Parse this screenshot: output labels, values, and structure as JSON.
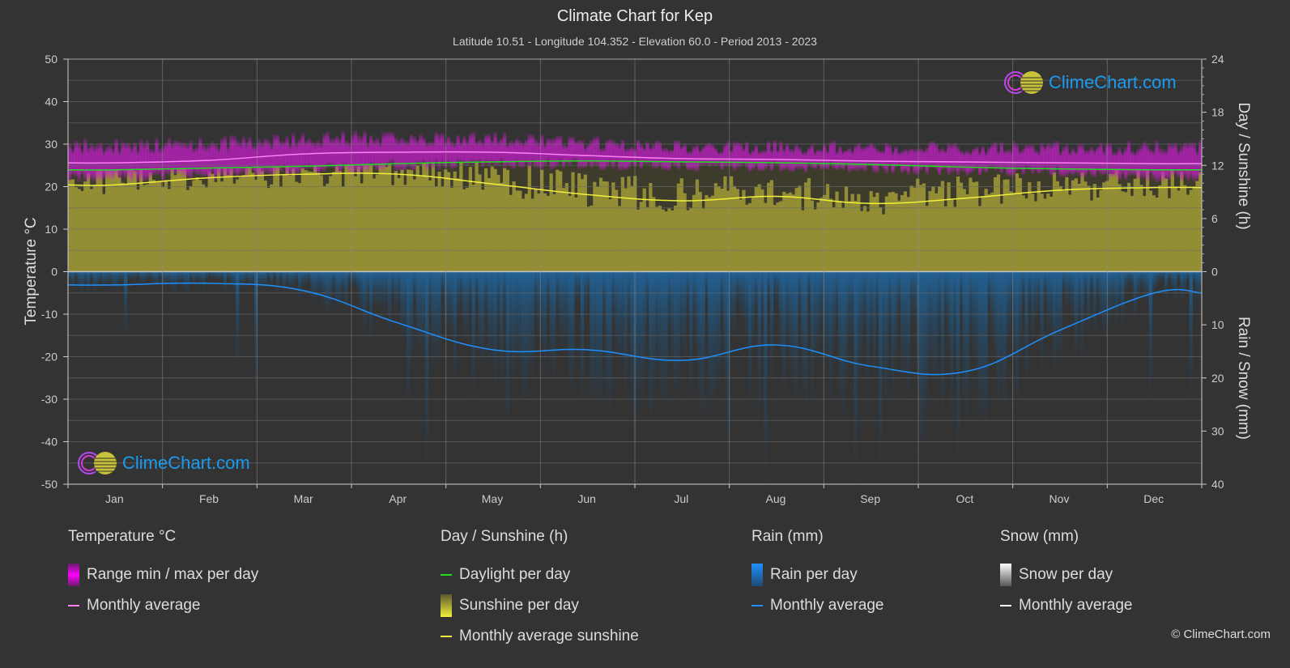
{
  "header": {
    "title": "Climate Chart for Kep",
    "subtitle": "Latitude 10.51 - Longitude 104.352 - Elevation 60.0 - Period 2013 - 2023"
  },
  "logo_text": "ClimeChart.com",
  "copyright": "© ClimeChart.com",
  "colors": {
    "background": "#333333",
    "temp_range": "#c81ecb",
    "temp_avg": "#ff7ff5",
    "daylight": "#22dd22",
    "sunshine_fill": "#9b9636",
    "sunshine_avg": "#f2f03a",
    "rain_fill": "#1e6aa8",
    "rain_avg": "#1e90ff",
    "snow_avg": "#ffffff",
    "grid": "#5c5c5c",
    "logo": "#1a9bf0"
  },
  "legend": {
    "temperature": {
      "title": "Temperature °C",
      "items": [
        "Range min / max per day",
        "Monthly average"
      ]
    },
    "sunshine": {
      "title": "Day / Sunshine (h)",
      "items": [
        "Daylight per day",
        "Sunshine per day",
        "Monthly average sunshine"
      ]
    },
    "rain": {
      "title": "Rain (mm)",
      "items": [
        "Rain per day",
        "Monthly average"
      ]
    },
    "snow": {
      "title": "Snow (mm)",
      "items": [
        "Snow per day",
        "Monthly average"
      ]
    }
  },
  "chart_data": {
    "type": "line",
    "title": "Climate Chart for Kep",
    "subtitle": "Latitude 10.51 - Longitude 104.352 - Elevation 60.0 - Period 2013 - 2023",
    "categories": [
      "Jan",
      "Feb",
      "Mar",
      "Apr",
      "May",
      "Jun",
      "Jul",
      "Aug",
      "Sep",
      "Oct",
      "Nov",
      "Dec"
    ],
    "axes": {
      "left": {
        "label": "Temperature °C",
        "range": [
          -50,
          50
        ],
        "ticks": [
          50,
          40,
          30,
          20,
          10,
          0,
          -10,
          -20,
          -30,
          -40,
          -50
        ]
      },
      "right_top": {
        "label": "Day / Sunshine (h)",
        "range": [
          0,
          24
        ],
        "ticks": [
          24,
          18,
          12,
          6,
          0
        ]
      },
      "right_bottom": {
        "label": "Rain / Snow (mm)",
        "range": [
          0,
          40
        ],
        "ticks": [
          0,
          10,
          20,
          30,
          40
        ]
      }
    },
    "grid": true,
    "legend_position": "bottom",
    "series": [
      {
        "name": "Temperature monthly average",
        "axis": "left",
        "unit": "°C",
        "values": [
          25.6,
          26.2,
          27.7,
          28.1,
          28.1,
          27.3,
          26.6,
          26.4,
          26.0,
          25.8,
          25.6,
          25.4
        ]
      },
      {
        "name": "Temperature daily max (approx band top)",
        "axis": "left",
        "unit": "°C",
        "values": [
          30.0,
          30.5,
          31.5,
          32.0,
          31.5,
          30.5,
          29.5,
          29.5,
          29.5,
          29.5,
          29.5,
          29.5
        ]
      },
      {
        "name": "Temperature daily min (approx band bottom)",
        "axis": "left",
        "unit": "°C",
        "values": [
          22.0,
          22.5,
          23.5,
          24.5,
          25.0,
          25.0,
          24.5,
          24.5,
          24.0,
          23.5,
          23.0,
          22.0
        ]
      },
      {
        "name": "Daylight per day",
        "axis": "right_top",
        "unit": "h",
        "values": [
          11.5,
          11.7,
          11.9,
          12.2,
          12.4,
          12.5,
          12.4,
          12.3,
          12.1,
          11.8,
          11.6,
          11.5
        ]
      },
      {
        "name": "Monthly average sunshine",
        "axis": "right_top",
        "unit": "h",
        "values": [
          9.8,
          10.6,
          11.0,
          11.0,
          9.9,
          8.7,
          8.0,
          8.5,
          7.7,
          8.3,
          9.2,
          9.5
        ]
      },
      {
        "name": "Rain monthly average",
        "axis": "right_bottom",
        "unit": "mm",
        "values": [
          2.5,
          2.2,
          3.6,
          9.7,
          14.7,
          14.7,
          16.7,
          13.8,
          17.8,
          18.8,
          11.0,
          4.0
        ]
      },
      {
        "name": "Snow monthly average",
        "axis": "right_bottom",
        "unit": "mm",
        "values": [
          0,
          0,
          0,
          0,
          0,
          0,
          0,
          0,
          0,
          0,
          0,
          0
        ]
      }
    ]
  }
}
